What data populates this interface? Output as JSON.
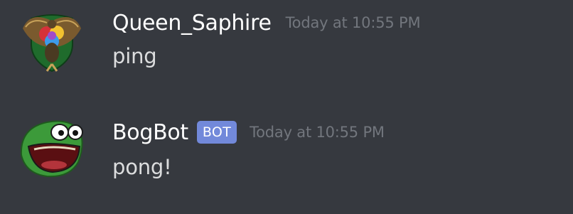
{
  "theme": {
    "background": "#36393f",
    "username_color": "#ffffff",
    "content_color": "#dcddde",
    "timestamp_color": "#72767d",
    "bot_tag_color": "#7289da"
  },
  "messages": [
    {
      "avatar_icon": "crest-avatar-icon",
      "username": "Queen_Saphire",
      "timestamp": "Today at 10:55 PM",
      "content": "ping"
    },
    {
      "avatar_icon": "frog-avatar-icon",
      "username": "BogBot",
      "bot_tag": "BOT",
      "timestamp": "Today at 10:55 PM",
      "content": "pong!"
    }
  ]
}
